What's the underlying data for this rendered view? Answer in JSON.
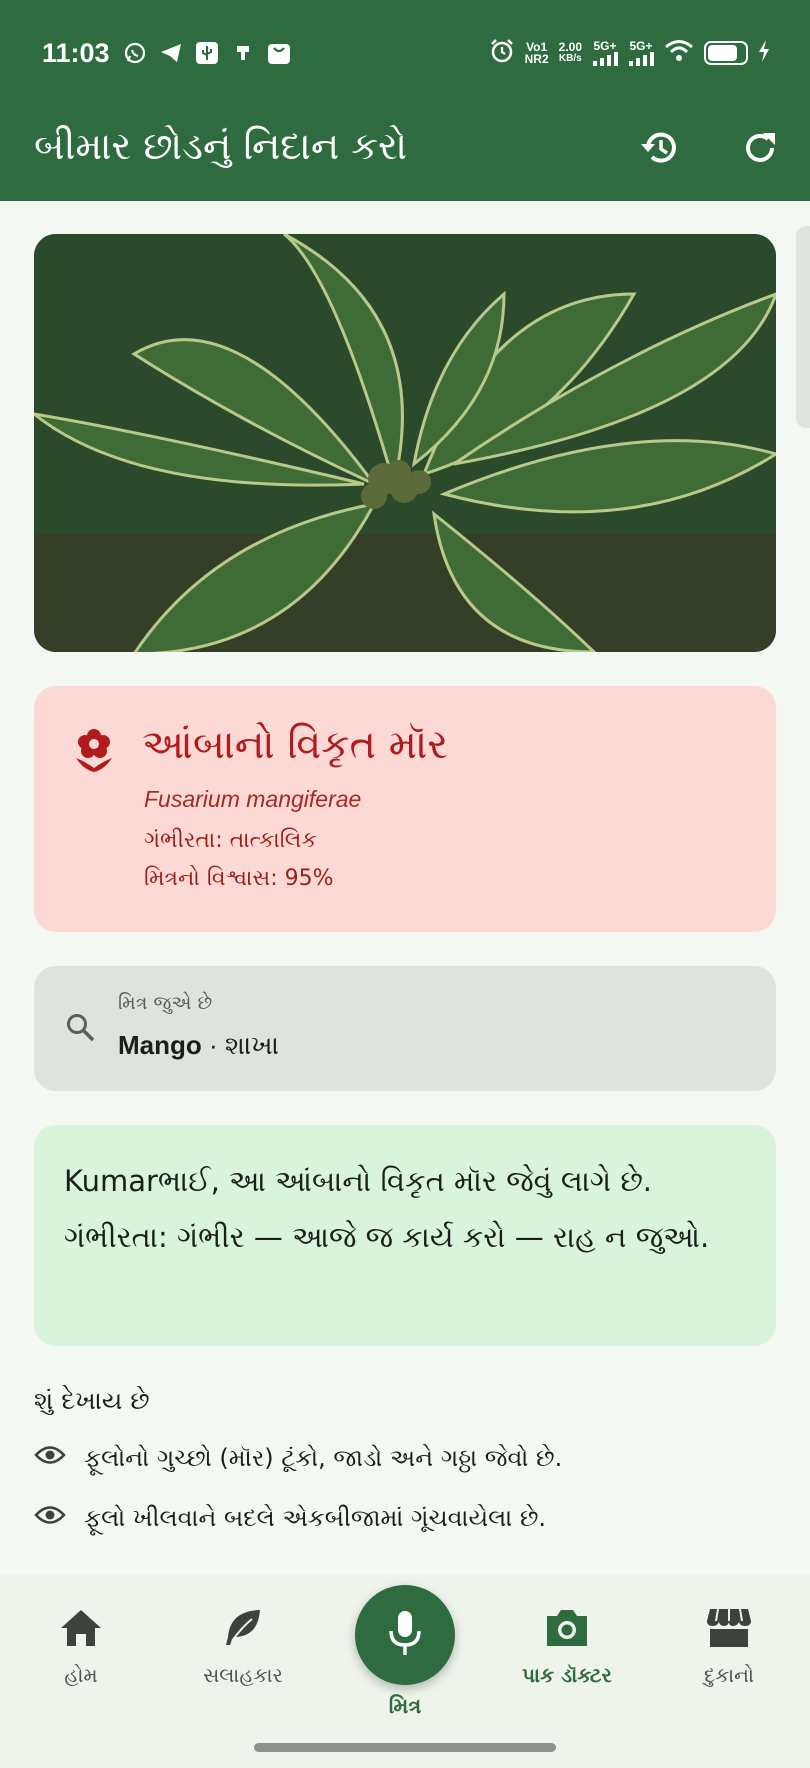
{
  "status_bar": {
    "time": "11:03",
    "network_1": "Vo1",
    "network_2": "NR2",
    "speed_value": "2.00",
    "speed_unit": "KB/s",
    "sim1": "5G+",
    "sim2": "5G+",
    "icons": [
      "whatsapp-icon",
      "telegram-icon",
      "usb-icon",
      "charging-icon",
      "shopping-bag-icon",
      "alarm-icon",
      "wifi-icon",
      "battery-icon",
      "bolt-icon"
    ],
    "battery_level": 0.8
  },
  "appbar": {
    "title": "બીમાર છોડનું નિદાન કરો",
    "history_icon": "history-icon",
    "refresh_icon": "refresh-icon"
  },
  "diagnosis": {
    "icon": "flower-icon",
    "title": "આંબાનો વિકૃત મૉર",
    "scientific_name": "Fusarium mangiferae",
    "severity": "ગંભીરતા: તાત્કાલિક",
    "confidence": "મિત્રનો વિશ્વાસ: 95%",
    "color": "#b01c1c"
  },
  "looking": {
    "caption": "મિત્ર જુએ છે",
    "crop": "Mango",
    "part": " · શાખા"
  },
  "speech": {
    "text": "Kumarભાઈ, આ આંબાનો વિકૃત મૉર જેવું લાગે છે. ગંભીરતા: ગંભીર — આજે જ કાર્ય કરો — રાહ ન જુઓ."
  },
  "observations": {
    "title": "શું દેખાય છે",
    "items": [
      "ફૂલોનો ગુચ્છો (મૉર) ટૂંકો, જાડો અને ગઠ્ઠા જેવો છે.",
      "ફૂલો ખીલવાને બદલે એકબીજામાં ગૂંચવાયેલા છે."
    ]
  },
  "bottom_nav": {
    "items": [
      {
        "label": "હોમ",
        "icon": "home-icon"
      },
      {
        "label": "સલાહકાર",
        "icon": "leaf-icon"
      },
      {
        "label": "પાક ડૉક્ટર",
        "icon": "camera-icon"
      },
      {
        "label": "દુકાનો",
        "icon": "store-icon"
      }
    ],
    "fab_label": "મિત્ર",
    "fab_icon": "mic-icon",
    "active_index": 2,
    "accent": "#2e6b3f"
  }
}
